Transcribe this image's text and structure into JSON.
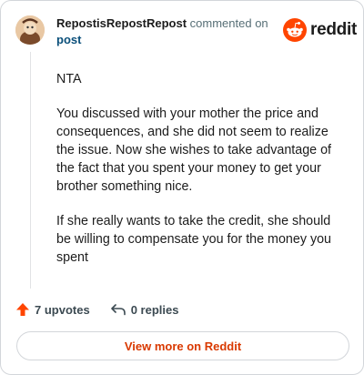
{
  "header": {
    "author": "RepostisRepostRepost",
    "action_text": "commented on",
    "target": "post",
    "brand": "reddit"
  },
  "comment": {
    "paragraphs": [
      "NTA",
      "You discussed with your mother the price and consequences, and she did not seem to realize the issue. Now she wishes to take advantage of the fact that you spent your money to get your brother something nice.",
      "If she really wants to take the credit, she should be willing to compensate you for the money you spent"
    ]
  },
  "actions": {
    "upvotes": "7 upvotes",
    "replies": "0 replies"
  },
  "footer": {
    "view_more": "View more on Reddit"
  },
  "colors": {
    "brand_orange": "#ff4500",
    "link_blue": "#0a4f7a",
    "cta_orange": "#d93900"
  },
  "icons": [
    "avatar-icon",
    "reddit-logo-icon",
    "upvote-arrow-icon",
    "reply-arrow-icon"
  ]
}
